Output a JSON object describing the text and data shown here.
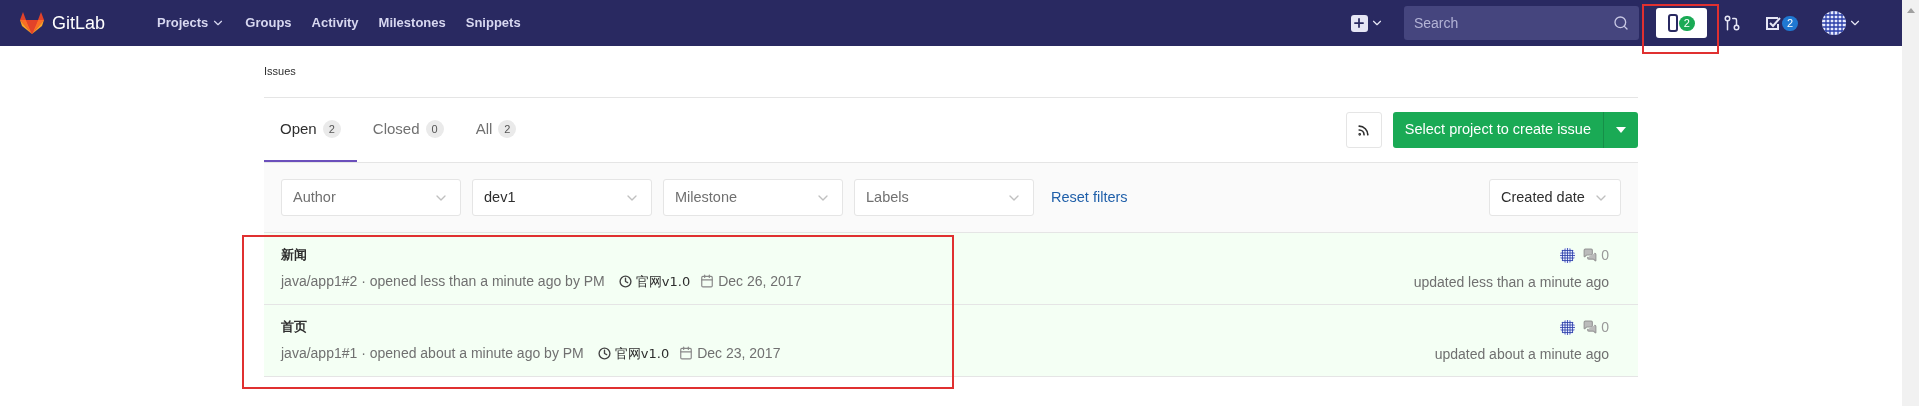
{
  "navbar": {
    "brand": "GitLab",
    "links": [
      {
        "label": "Projects",
        "caret": true
      },
      {
        "label": "Groups",
        "caret": false
      },
      {
        "label": "Activity",
        "caret": false
      },
      {
        "label": "Milestones",
        "caret": false
      },
      {
        "label": "Snippets",
        "caret": false
      }
    ],
    "search": {
      "placeholder": "Search"
    },
    "issues_count": "2",
    "issues_highlighted": true,
    "todos_count": "2"
  },
  "breadcrumb": "Issues",
  "tabs": [
    {
      "label": "Open",
      "count": "2",
      "selected": true
    },
    {
      "label": "Closed",
      "count": "0",
      "selected": false
    },
    {
      "label": "All",
      "count": "2",
      "selected": false
    }
  ],
  "create_button": "Select project to create issue",
  "filters": [
    {
      "label": "Author",
      "set": false
    },
    {
      "label": "dev1",
      "set": true
    },
    {
      "label": "Milestone",
      "set": false
    },
    {
      "label": "Labels",
      "set": false
    }
  ],
  "reset_link": "Reset filters",
  "sort": "Created date",
  "issues_highlighted": true,
  "issues": [
    {
      "title": "新闻",
      "meta": "java/app1#2 · opened less than a minute ago by PM",
      "milestone": "官网v1.0",
      "due": "Dec 26, 2017",
      "comments": "0",
      "updated": "updated less than a minute ago"
    },
    {
      "title": "首页",
      "meta": "java/app1#1 · opened about a minute ago by PM",
      "milestone": "官网v1.0",
      "due": "Dec 23, 2017",
      "comments": "0",
      "updated": "updated about a minute ago"
    }
  ]
}
